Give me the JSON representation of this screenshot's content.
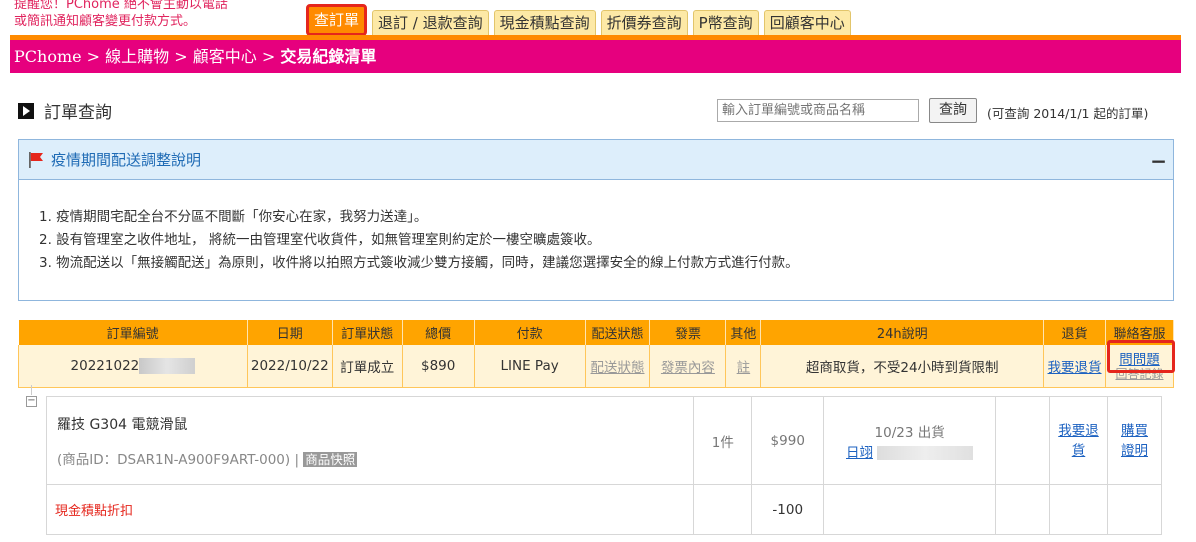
{
  "notice": {
    "line1": "提醒您！PChome 絕不會主動以電話",
    "line2": "或簡訊通知顧客變更付款方式。"
  },
  "tabs": [
    {
      "label": "查訂單",
      "active": true
    },
    {
      "label": "退訂 / 退款查詢",
      "active": false
    },
    {
      "label": "現金積點查詢",
      "active": false
    },
    {
      "label": "折價券查詢",
      "active": false
    },
    {
      "label": "P幣查詢",
      "active": false
    },
    {
      "label": "回顧客中心",
      "active": false
    }
  ],
  "breadcrumb": {
    "path": "PChome > 線上購物 > 顧客中心 > ",
    "current": "交易紀錄清單"
  },
  "order_query": {
    "title": "訂單查詢",
    "search_placeholder": "輸入訂單編號或商品名稱",
    "search_button": "查詢",
    "hint": "(可查詢 2014/1/1 起的訂單)"
  },
  "epidemic": {
    "title": "疫情期間配送調整說明",
    "collapse": "−",
    "items": [
      "1. 疫情期間宅配全台不分區不間斷「你安心在家，我努力送達」。",
      "2. 設有管理室之收件地址， 將統一由管理室代收貨件，如無管理室則約定於一樓空曠處簽收。",
      "3. 物流配送以「無接觸配送」為原則，收件將以拍照方式簽收減少雙方接觸，同時，建議您選擇安全的線上付款方式進行付款。"
    ]
  },
  "order_table": {
    "headers": [
      "訂單編號",
      "日期",
      "訂單狀態",
      "總價",
      "付款",
      "配送狀態",
      "發票",
      "其他",
      "24h說明",
      "退貨",
      "聯絡客服"
    ],
    "row": {
      "order_no": "20221022",
      "date": "2022/10/22",
      "status": "訂單成立",
      "total": "$890",
      "payment": "LINE Pay",
      "ship_status": "配送狀態",
      "invoice": "發票內容",
      "other": "註",
      "note": "超商取貨，不受24小時到貨限制",
      "return": "我要退貨",
      "ask": "問問題",
      "reply": "回答記錄"
    }
  },
  "product": {
    "tree_toggle": "−",
    "name": "羅技 G304 電競滑鼠",
    "id": "(商品ID：DSAR1N-A900F9ART-000)",
    "separator": "|",
    "snapshot": "商品快照",
    "qty": "1件",
    "price": "$990",
    "ship_date": "10/23 出貨",
    "ship_link": "日翊",
    "return_link": "我要退貨",
    "proof_link": "購買證明"
  },
  "discount": {
    "label": "現金積點折扣",
    "amount": "-100"
  },
  "colors": {
    "accent_orange": "#ff8a00",
    "breadcrumb_pink": "#e6007e",
    "highlight_red": "#e5261c",
    "link_blue": "#1d62c1"
  }
}
